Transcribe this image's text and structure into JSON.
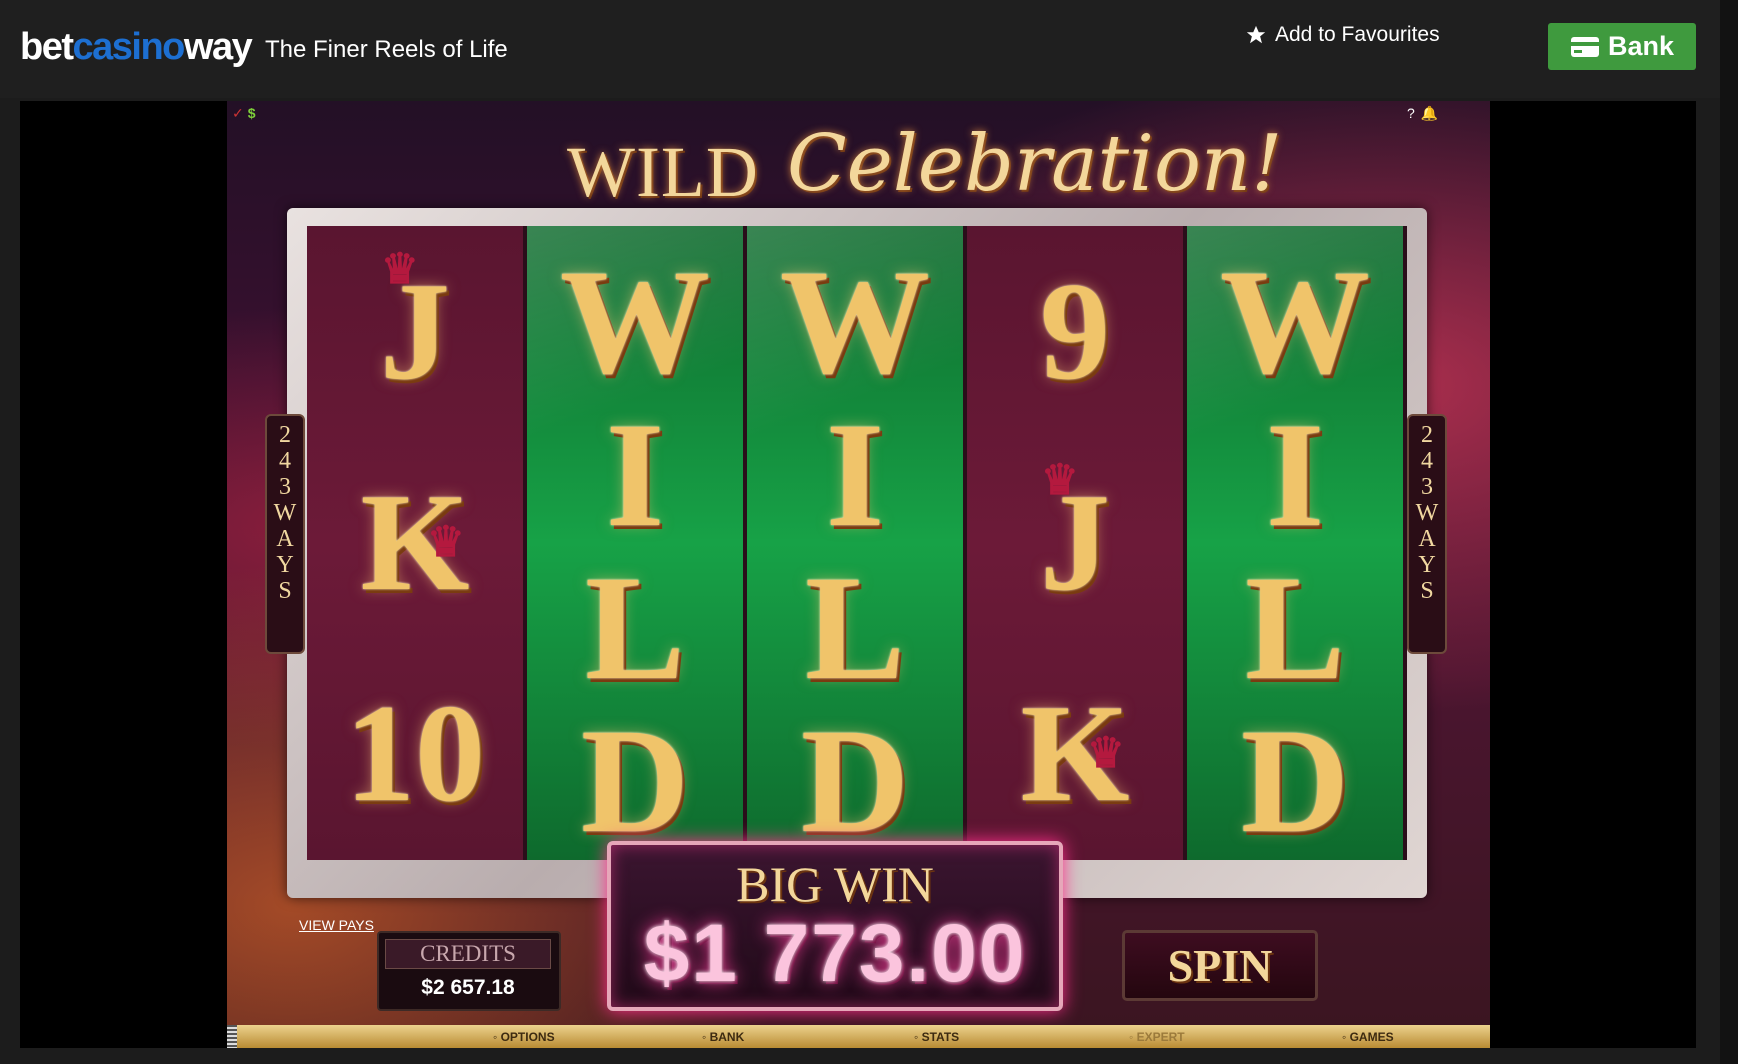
{
  "header": {
    "logo_part1": "bet",
    "logo_part2": "casino",
    "logo_part3": "way",
    "tagline": "The Finer Reels of Life",
    "favourites_label": "Add to Favourites",
    "bank_label": "Bank"
  },
  "colors": {
    "brand_blue": "#1d6fd1",
    "bank_green": "#3f9a3e",
    "gold": "#f0c46a",
    "pink": "#fbc4dd"
  },
  "game": {
    "title_wild": "WILD",
    "title_celebration": "Celebration!",
    "top_left_icons": [
      "✓",
      "$"
    ],
    "top_right_icons": [
      "?",
      "🔔"
    ],
    "ways_text": [
      "2",
      "4",
      "3",
      "W",
      "A",
      "Y",
      "S"
    ],
    "reels": [
      {
        "type": "red",
        "symbols": [
          "J",
          "K",
          "10"
        ]
      },
      {
        "type": "green",
        "symbols": [
          "W",
          "I",
          "L",
          "D"
        ]
      },
      {
        "type": "green",
        "symbols": [
          "W",
          "I",
          "L",
          "D"
        ]
      },
      {
        "type": "red",
        "symbols": [
          "9",
          "J",
          "K"
        ]
      },
      {
        "type": "green",
        "symbols": [
          "W",
          "I",
          "L",
          "D"
        ]
      }
    ],
    "view_pays": "VIEW PAYS",
    "credits_label": "CREDITS",
    "credits_value": "$2 657.18",
    "big_win_title": "BIG WIN",
    "big_win_amount": "$1 773.00",
    "spin_label": "SPIN",
    "menu": [
      "OPTIONS",
      "BANK",
      "STATS",
      "EXPERT",
      "GAMES"
    ]
  }
}
